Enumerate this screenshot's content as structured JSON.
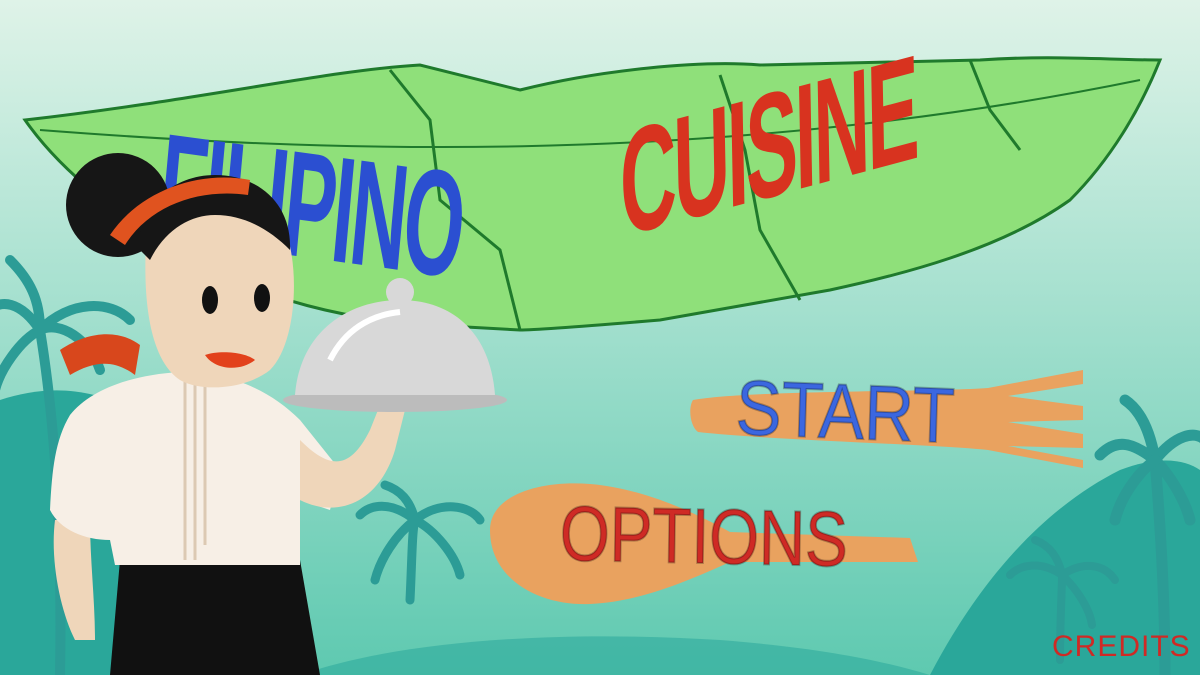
{
  "title": {
    "word1": "FILIPINO",
    "word2": "CUISINE"
  },
  "menu": {
    "start_label": "START",
    "options_label": "OPTIONS",
    "credits_label": "CREDITS"
  },
  "colors": {
    "sky_top": "#dff3e8",
    "sky_bottom": "#5ec9b0",
    "hill": "#2aa79a",
    "palm": "#2c9c96",
    "leaf": "#8fe07a",
    "leaf_edge": "#1f7a2c",
    "title_blue": "#2b4fd1",
    "title_red": "#d8331f",
    "utensil_orange": "#e9a25f",
    "label_blue": "#3b67e0",
    "label_red": "#cf2a25"
  },
  "icons": {
    "start_background": "fork-icon",
    "options_background": "spoon-icon",
    "tray": "cloche-icon"
  }
}
